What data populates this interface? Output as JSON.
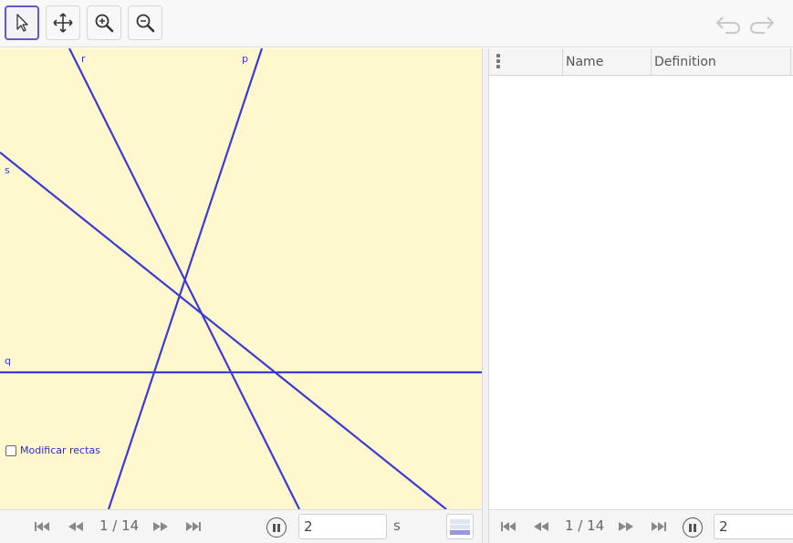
{
  "toolbar": {
    "tools": [
      {
        "name": "move",
        "icon": "arrow-cursor-icon",
        "selected": true
      },
      {
        "name": "move-graphics-view",
        "icon": "move-arrows-icon",
        "selected": false
      },
      {
        "name": "zoom-in",
        "icon": "zoom-in-icon",
        "selected": false
      },
      {
        "name": "zoom-out",
        "icon": "zoom-out-icon",
        "selected": false
      }
    ],
    "undo_icon": "undo-icon",
    "redo_icon": "redo-icon"
  },
  "graphics": {
    "background": "#fff8cf",
    "line_color": "#3a3ad8",
    "lines": [
      "r",
      "p",
      "s",
      "q"
    ],
    "labels": {
      "r": "r",
      "p": "p",
      "s": "s",
      "q": "q"
    },
    "checkbox": {
      "label": "Modificar rectas",
      "checked": false
    }
  },
  "table": {
    "columns": [
      "Name",
      "Definition"
    ]
  },
  "playback_left": {
    "counter": "1 / 14",
    "speed_value": "2",
    "speed_unit": "s"
  },
  "playback_right": {
    "counter": "1 / 14",
    "speed_value": "2"
  }
}
